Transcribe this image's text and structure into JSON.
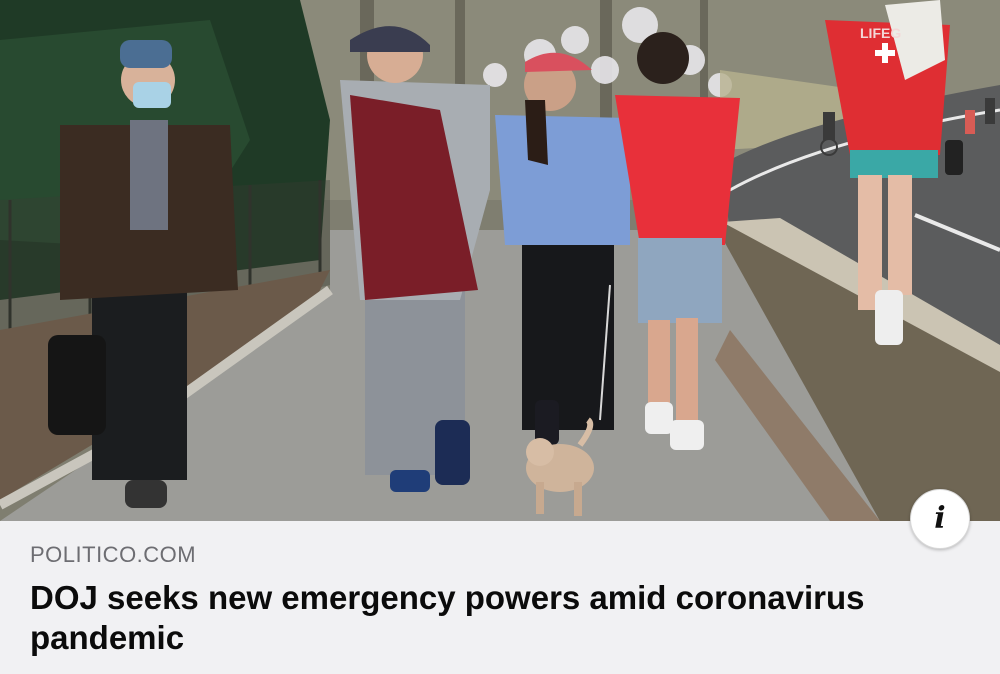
{
  "article": {
    "source": "POLITICO.COM",
    "headline": "DOJ seeks new emergency powers amid coronavirus pandemic"
  },
  "image": {
    "shirt_text": "LIFEG"
  },
  "info_button": {
    "glyph": "i",
    "icon": "info-icon"
  },
  "colors": {
    "caption_background": "#f1f1f3",
    "source_text": "#6d6d72",
    "headline_text": "#0b0b0b"
  }
}
